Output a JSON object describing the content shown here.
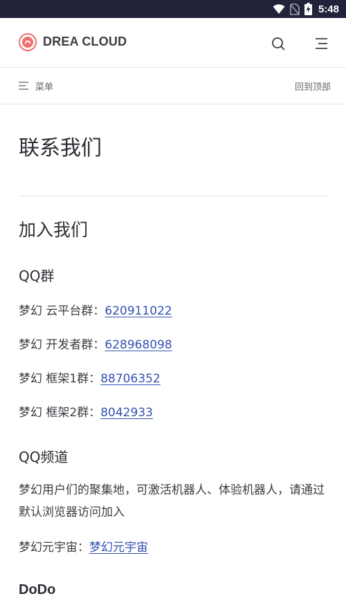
{
  "status_bar": {
    "time": "5:48"
  },
  "navbar": {
    "site_name": "DREA CLOUD"
  },
  "local_nav": {
    "menu_label": "菜单",
    "back_to_top": "回到顶部"
  },
  "page": {
    "title": "联系我们",
    "section_title": "加入我们",
    "qq_group": {
      "heading": "QQ群",
      "items": [
        {
          "label": "梦幻 云平台群：",
          "link": "620911022"
        },
        {
          "label": "梦幻 开发者群：",
          "link": "628968098"
        },
        {
          "label": "梦幻 框架1群：",
          "link": "88706352"
        },
        {
          "label": "梦幻 框架2群：",
          "link": "8042933"
        }
      ]
    },
    "qq_channel": {
      "heading": "QQ频道",
      "description": "梦幻用户们的聚集地，可激活机器人、体验机器人，请通过默认浏览器访问加入",
      "label": "梦幻元宇宙：",
      "link": "梦幻元宇宙"
    },
    "dodo": {
      "heading": "DoDo"
    }
  }
}
